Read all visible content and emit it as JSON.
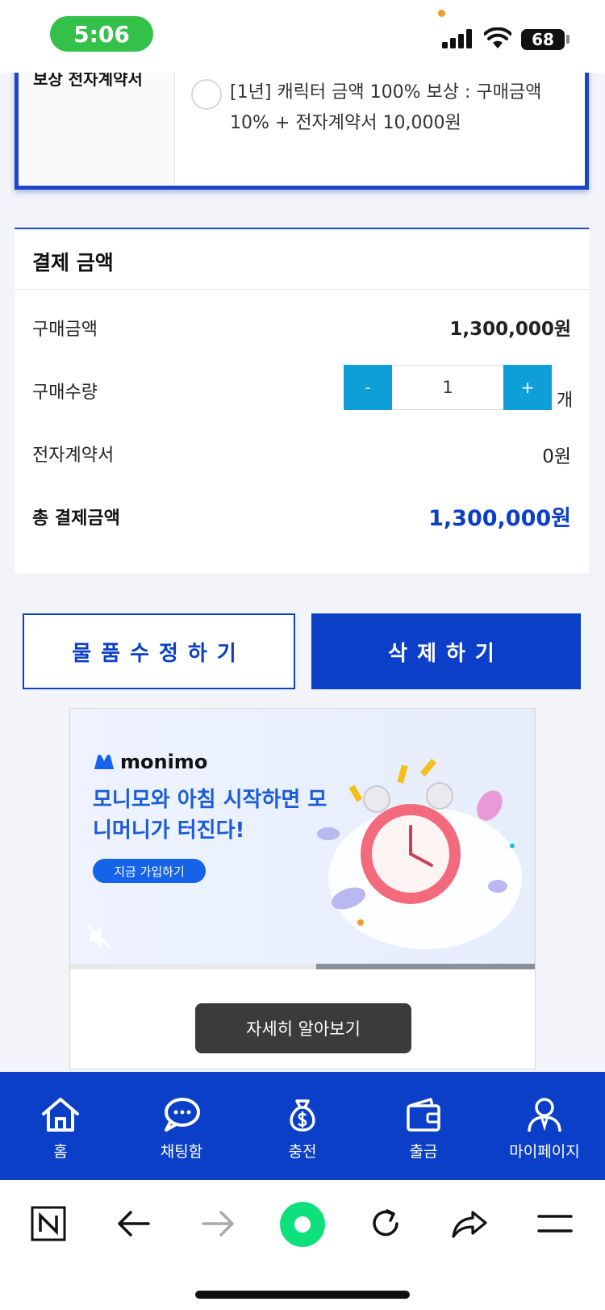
{
  "status_bar": {
    "time": "5:06",
    "battery": "68"
  },
  "option": {
    "left_label": "보상 전자계약서",
    "text": "[1년] 캐릭터 금액 100% 보상 : 구매금액 10% + 전자계약서 10,000원"
  },
  "payment": {
    "title": "결제 금액",
    "purchase_amount_label": "구매금액",
    "purchase_amount_value": "1,300,000원",
    "quantity_label": "구매수량",
    "quantity_minus": "-",
    "quantity_value": "1",
    "quantity_plus": "+",
    "quantity_unit": "개",
    "contract_label": "전자계약서",
    "contract_value": "0원",
    "total_label": "총 결제금액",
    "total_value": "1,300,000원"
  },
  "actions": {
    "edit_label": "물품수정하기",
    "delete_label": "삭제하기"
  },
  "ad": {
    "brand": "monimo",
    "headline": "모니모와 아침 시작하면 모니머니가 터진다!",
    "cta": "지금 가입하기",
    "progress": 0.53,
    "more_button": "자세히 알아보기"
  },
  "nav": {
    "items": [
      {
        "label": "홈",
        "icon": "home-icon"
      },
      {
        "label": "채팅함",
        "icon": "chat-icon"
      },
      {
        "label": "충전",
        "icon": "money-bag-icon"
      },
      {
        "label": "출금",
        "icon": "wallet-icon"
      },
      {
        "label": "마이페이지",
        "icon": "user-icon"
      }
    ]
  },
  "browser_bar": {
    "items": [
      "naver-n-icon",
      "back-arrow-icon",
      "forward-arrow-icon",
      "green-dot-icon",
      "refresh-icon",
      "share-icon",
      "menu-icon"
    ]
  },
  "colors": {
    "primary": "#0b3fc7",
    "stepper": "#0f9fd7",
    "ad_accent": "#1a5bd6"
  }
}
